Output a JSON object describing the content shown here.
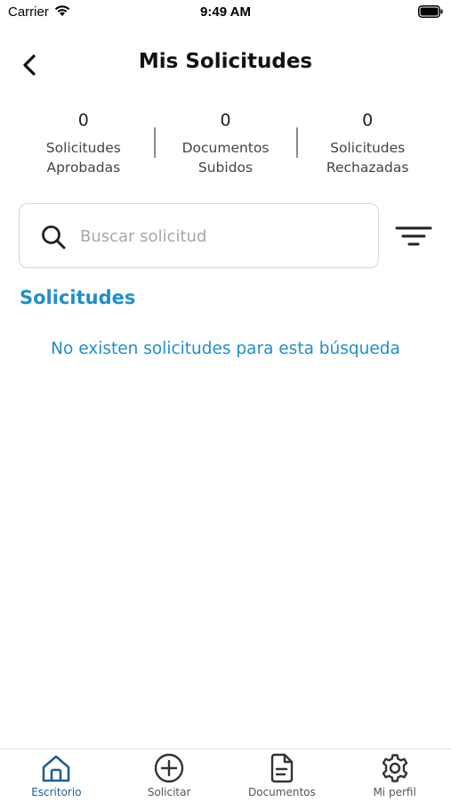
{
  "status_bar": {
    "carrier": "Carrier",
    "time": "9:49 AM"
  },
  "header": {
    "title": "Mis Solicitudes",
    "back_icon": "chevron-left-icon"
  },
  "stats": [
    {
      "count": "0",
      "line1": "Solicitudes",
      "line2": "Aprobadas"
    },
    {
      "count": "0",
      "line1": "Documentos",
      "line2": "Subidos"
    },
    {
      "count": "0",
      "line1": "Solicitudes",
      "line2": "Rechazadas"
    }
  ],
  "search": {
    "placeholder": "Buscar solicitud",
    "value": "",
    "icon": "search-icon",
    "filter_icon": "filter-icon"
  },
  "section": {
    "title": "Solicitudes",
    "empty_message": "No existen solicitudes para esta búsqueda"
  },
  "tabs": [
    {
      "label": "Escritorio",
      "icon": "home-icon",
      "active": true
    },
    {
      "label": "Solicitar",
      "icon": "plus-circle-icon",
      "active": false
    },
    {
      "label": "Documentos",
      "icon": "document-icon",
      "active": false
    },
    {
      "label": "Mi perfil",
      "icon": "gear-icon",
      "active": false
    }
  ],
  "colors": {
    "accent": "#1f8ecd",
    "active_tab": "#1f5f96",
    "text": "#111111",
    "muted": "#a7a7a7"
  }
}
